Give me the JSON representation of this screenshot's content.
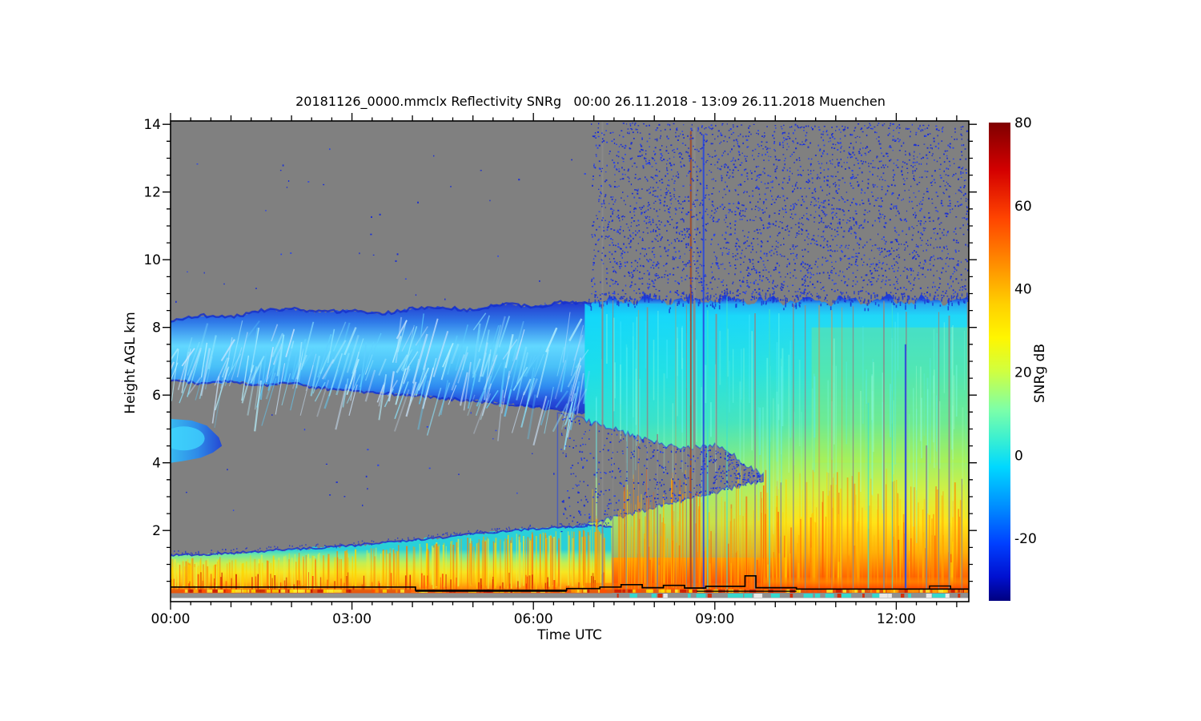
{
  "title": "20181126_0000.mmclx Reflectivity SNRg   00:00 26.11.2018 - 13:09 26.11.2018 Muenchen",
  "x_axis": {
    "label": "Time UTC",
    "tick_labels": [
      "00:00",
      "03:00",
      "06:00",
      "09:00",
      "12:00"
    ],
    "tick_hours": [
      0,
      3,
      6,
      9,
      12
    ],
    "minor_step_minutes": 20,
    "range_hours": [
      0,
      13.2
    ]
  },
  "y_axis": {
    "label": "Height AGL km",
    "tick_labels": [
      "2",
      "4",
      "6",
      "8",
      "10",
      "12",
      "14"
    ],
    "tick_km": [
      2,
      4,
      6,
      8,
      10,
      12,
      14
    ],
    "minor_step_km": 0.5,
    "range_km": [
      -0.1,
      14.1
    ]
  },
  "colorbar": {
    "label": "SNRg dB",
    "tick_labels": [
      "80",
      "60",
      "40",
      "20",
      "0",
      "-20"
    ],
    "tick_values": [
      80,
      60,
      40,
      20,
      0,
      -20
    ],
    "range_db": [
      -35,
      80
    ]
  },
  "colors": {
    "background": "#ffffff",
    "no_signal_gray": "#808080",
    "speckle_blue": "#2133cc",
    "axis": "#000000"
  },
  "chart_data": {
    "type": "heatmap",
    "title": "20181126_0000.mmclx Reflectivity SNRg   00:00 26.11.2018 - 13:09 26.11.2018 Muenchen",
    "xlabel": "Time UTC",
    "ylabel": "Height AGL km",
    "x_range_hours_utc": [
      0,
      13.2
    ],
    "y_range_km": [
      -0.1,
      14.1
    ],
    "colorbar": {
      "label": "SNRg dB",
      "min": -35,
      "max": 80
    },
    "features": {
      "cirrus_cloud_layer": {
        "t": [
          0,
          0.5,
          1,
          1.5,
          2,
          2.5,
          3,
          3.5,
          4,
          4.5,
          5,
          5.5,
          6,
          6.5,
          7,
          7.2
        ],
        "top_km": [
          8.2,
          8.35,
          8.3,
          8.5,
          8.55,
          8.45,
          8.5,
          8.4,
          8.55,
          8.6,
          8.5,
          8.7,
          8.6,
          8.75,
          8.7,
          8.75
        ],
        "bottom_km": [
          6.45,
          6.35,
          6.4,
          6.3,
          6.35,
          6.2,
          6.15,
          6.05,
          6.0,
          5.9,
          5.85,
          5.75,
          5.65,
          5.55,
          5.4,
          5.35
        ],
        "snr_db_range": [
          -20,
          10
        ]
      },
      "mid_level_cloud_patch": {
        "polygon_t_km": [
          [
            0,
            5.3
          ],
          [
            0.35,
            5.25
          ],
          [
            0.6,
            5.1
          ],
          [
            0.8,
            4.75
          ],
          [
            0.85,
            4.5
          ],
          [
            0.7,
            4.3
          ],
          [
            0.5,
            4.15
          ],
          [
            0.2,
            4.05
          ],
          [
            0,
            4.0
          ]
        ]
      },
      "boundary_layer": {
        "t": [
          0,
          0.7,
          1.4,
          2,
          2.6,
          3.2,
          3.8,
          4.4,
          5,
          5.5,
          6,
          6.5,
          7,
          7.3
        ],
        "top_km": [
          1.27,
          1.3,
          1.38,
          1.45,
          1.5,
          1.58,
          1.68,
          1.78,
          1.9,
          1.98,
          2.05,
          2.1,
          2.15,
          2.1
        ],
        "bottom_km": 0.15,
        "snr_db_range": [
          10,
          60
        ]
      },
      "precipitation_column": {
        "t_start": 6.85,
        "t_end": 13.2,
        "top_km": 8.8,
        "bottom_km": 0.15
      },
      "clear_air_wedge": {
        "t0": 6.4,
        "t1": 9.8,
        "top0_km": 5.5,
        "top1_km": 3.62,
        "bot0_km": 1.95,
        "bot1_km": 3.5,
        "bump_t": 9.05,
        "bump_amp_km": 0.45,
        "bump_w": 0.45
      },
      "noise_speckle_region": {
        "t_start": 6.95,
        "t_end": 13.2,
        "bottom_km": 8.8,
        "top_km": 14.1
      },
      "surface_line": {
        "points_t_km": [
          [
            0,
            0.33
          ],
          [
            4.05,
            0.33
          ],
          [
            4.05,
            0.235
          ],
          [
            6.55,
            0.235
          ],
          [
            6.55,
            0.285
          ],
          [
            7.1,
            0.285
          ],
          [
            7.1,
            0.33
          ],
          [
            7.45,
            0.33
          ],
          [
            7.45,
            0.4
          ],
          [
            7.8,
            0.4
          ],
          [
            7.8,
            0.31
          ],
          [
            8.15,
            0.31
          ],
          [
            8.15,
            0.38
          ],
          [
            8.5,
            0.38
          ],
          [
            8.5,
            0.3
          ],
          [
            8.85,
            0.3
          ],
          [
            8.85,
            0.35
          ],
          [
            9.5,
            0.35
          ],
          [
            9.5,
            0.66
          ],
          [
            9.68,
            0.66
          ],
          [
            9.68,
            0.31
          ],
          [
            10.35,
            0.31
          ],
          [
            10.35,
            0.27
          ],
          [
            13.2,
            0.27
          ]
        ],
        "secondary_segments_t_km": [
          [
            4.05,
            0.205,
            6.55
          ],
          [
            8.7,
            0.205,
            10.35
          ]
        ],
        "step_box_t_km": [
          12.55,
          12.9,
          0.27,
          0.36
        ]
      },
      "data_gap_stripes": {
        "specials": [
          {
            "t": 7.13,
            "w": 2,
            "color": "#8a8a8a",
            "top_km": 14.1,
            "bot_km": 0.3
          },
          {
            "t": 8.59,
            "w": 2,
            "color": "#a04828",
            "top_km": 13.8,
            "bot_km": 0.2
          },
          {
            "t": 8.64,
            "w": 3,
            "color": "#8a8a8a",
            "top_km": 13.9,
            "bot_km": 0.15
          },
          {
            "t": 8.8,
            "w": 2,
            "color": "#2846e0",
            "top_km": 13.7,
            "bot_km": 0.2
          },
          {
            "t": 12.14,
            "w": 2,
            "color": "#2846e0",
            "top_km": 7.5,
            "bot_km": 0.3
          }
        ]
      }
    }
  }
}
